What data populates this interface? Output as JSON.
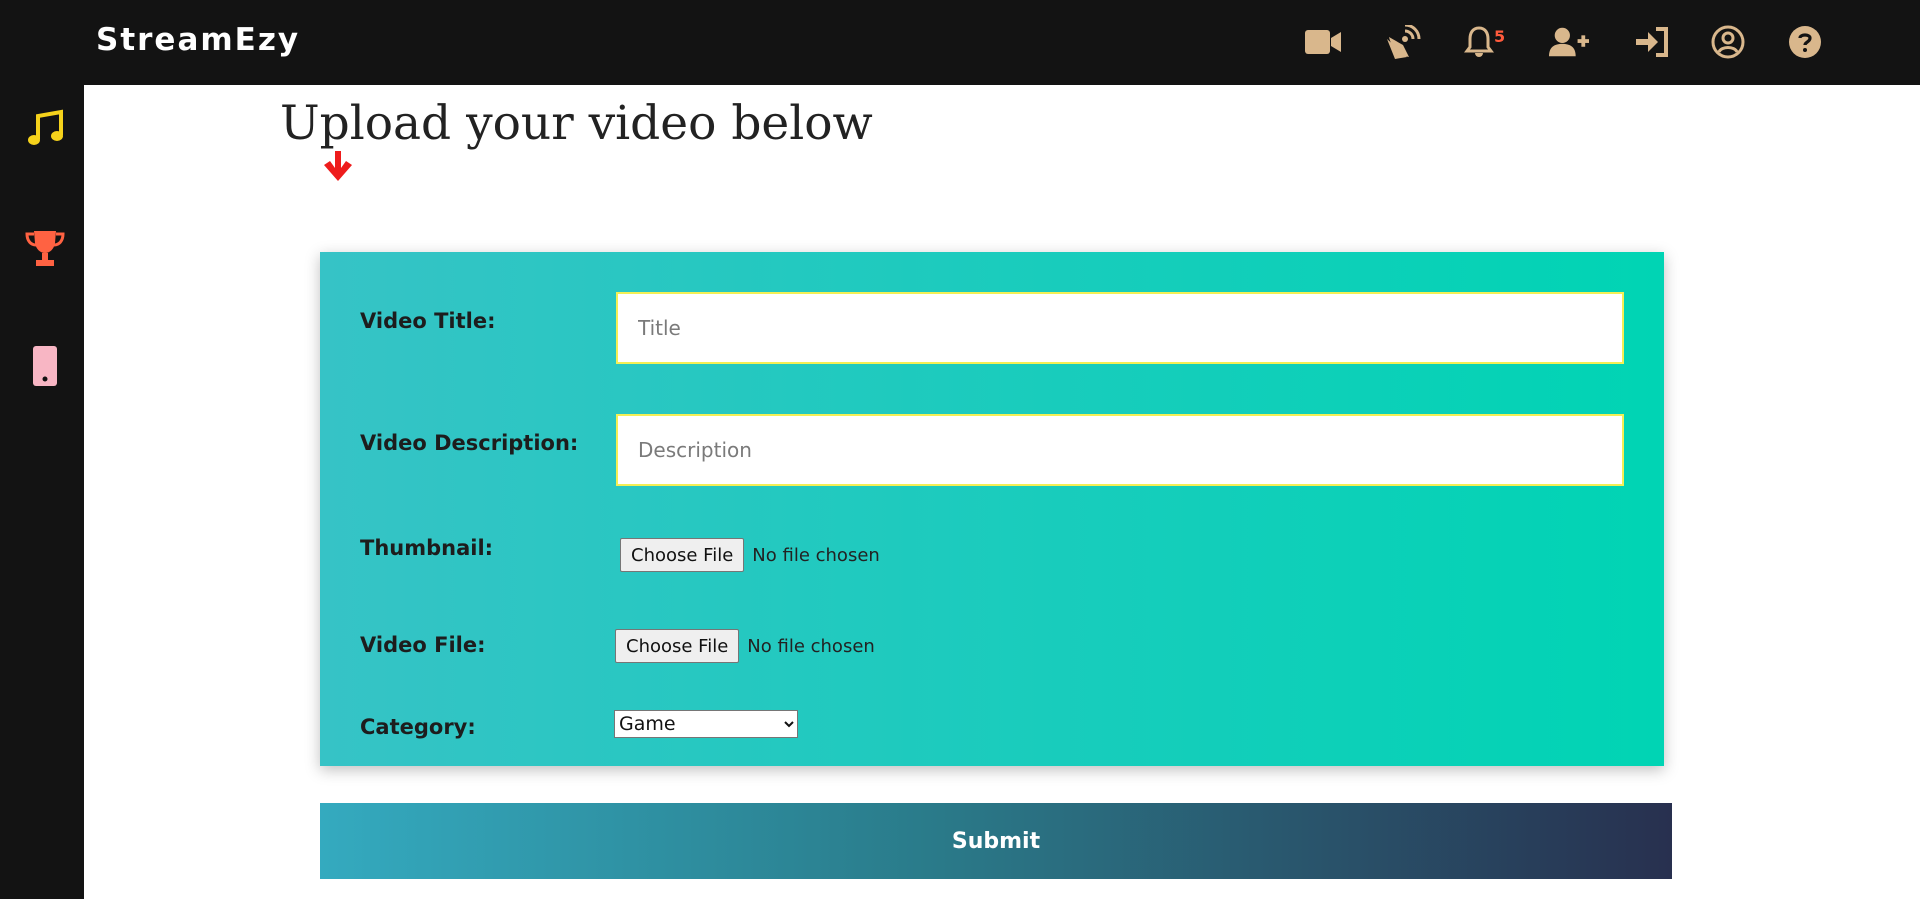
{
  "app": {
    "brand": "StreamEzy"
  },
  "topbar": {
    "icons": [
      {
        "name": "video-camera-icon"
      },
      {
        "name": "satellite-dish-icon"
      },
      {
        "name": "bell-icon"
      },
      {
        "name": "user-plus-icon"
      },
      {
        "name": "sign-in-icon"
      },
      {
        "name": "user-circle-icon"
      },
      {
        "name": "question-circle-icon"
      }
    ],
    "notification_count": "5",
    "icon_color": "#d9b78c"
  },
  "sidebar": {
    "items": [
      {
        "name": "music-note-icon",
        "color": "#f5d21b"
      },
      {
        "name": "trophy-icon",
        "color": "#ff6242"
      },
      {
        "name": "mobile-phone-icon",
        "color": "#f8b6c4"
      }
    ]
  },
  "page": {
    "heading": "Upload your video below"
  },
  "form": {
    "title_label": "Video Title:",
    "title_placeholder": "Title",
    "description_label": "Video Description:",
    "description_placeholder": "Description",
    "thumbnail_label": "Thumbnail:",
    "video_file_label": "Video File:",
    "choose_file_label": "Choose File",
    "no_file_text": "No file chosen",
    "category_label": "Category:",
    "category_selected": "Game",
    "submit_label": "Submit"
  }
}
